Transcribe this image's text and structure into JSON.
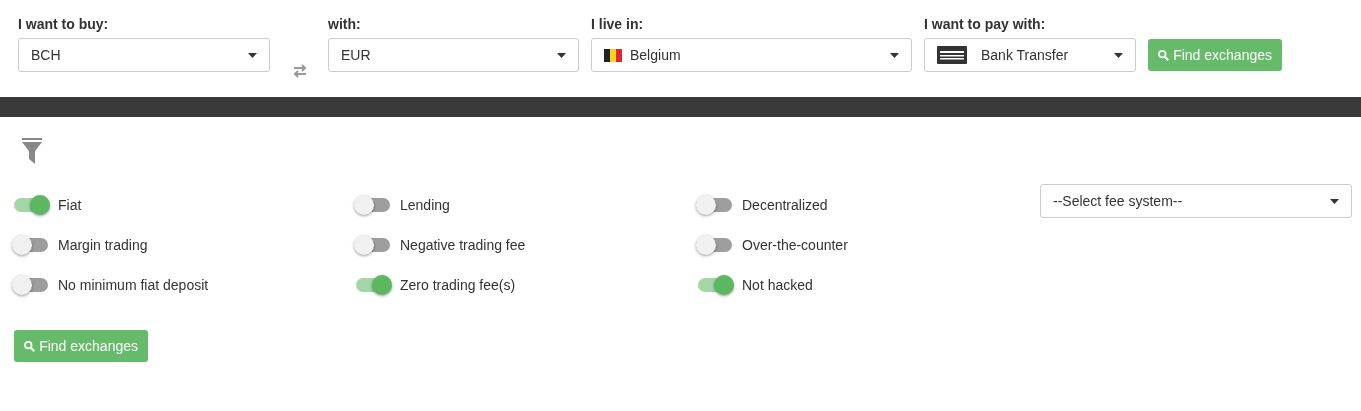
{
  "search_bar": {
    "fields": [
      {
        "label": "I want to buy:",
        "value": "BCH",
        "kind": "plain"
      },
      {
        "label": "with:",
        "value": "EUR",
        "kind": "plain"
      },
      {
        "label": "I live in:",
        "value": "Belgium",
        "kind": "flag"
      },
      {
        "label": "I want to pay with:",
        "value": "Bank Transfer",
        "kind": "bank"
      }
    ],
    "button": "Find exchanges"
  },
  "filters": {
    "toggles": [
      {
        "label": "Fiat",
        "on": true
      },
      {
        "label": "Lending",
        "on": false
      },
      {
        "label": "Decentralized",
        "on": false
      },
      {
        "label": "Margin trading",
        "on": false
      },
      {
        "label": "Negative trading fee",
        "on": false
      },
      {
        "label": "Over-the-counter",
        "on": false
      },
      {
        "label": "No minimum fiat deposit",
        "on": false
      },
      {
        "label": "Zero trading fee(s)",
        "on": true
      },
      {
        "label": "Not hacked",
        "on": true
      }
    ],
    "fee_select": {
      "placeholder": "--Select fee system--"
    },
    "button": "Find exchanges"
  }
}
